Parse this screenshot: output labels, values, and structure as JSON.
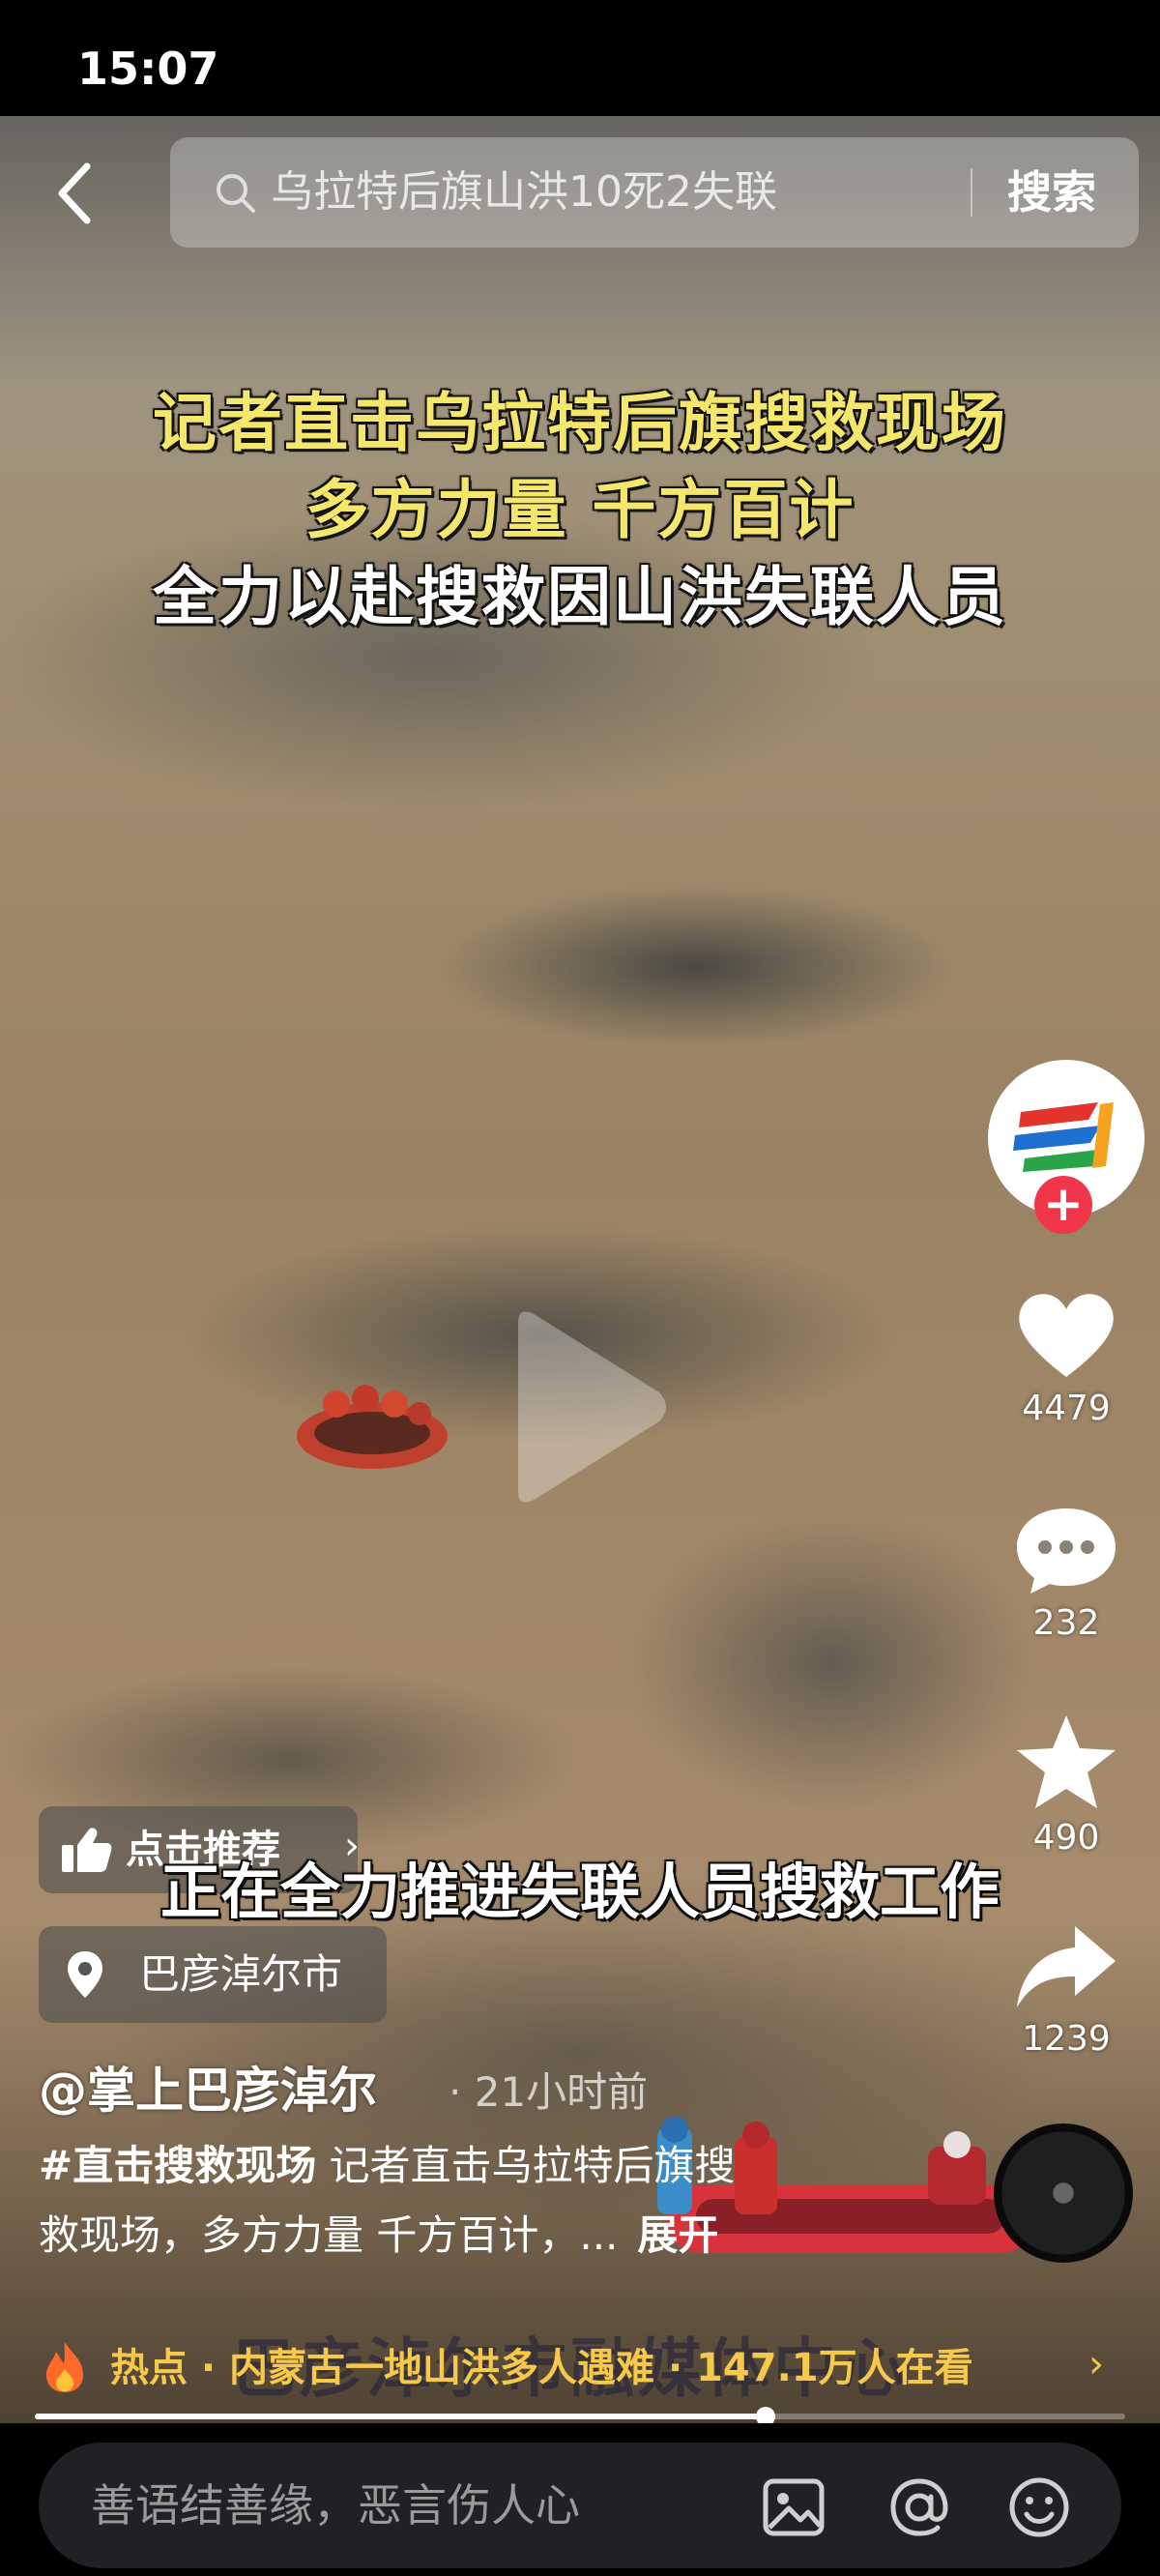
{
  "status_bar": {
    "time": "15:07"
  },
  "search": {
    "query": "乌拉特后旗山洪10死2失联",
    "button_label": "搜索"
  },
  "video": {
    "headline_lines": [
      "记者直击乌拉特后旗搜救现场",
      "多方力量 千方百计",
      "全力以赴搜救因山洪失联人员"
    ],
    "subtitle": "正在全力推进失联人员搜救工作",
    "watermark": "巴彦淖尔市融媒体中心"
  },
  "actions": {
    "like_count": "4479",
    "comment_count": "232",
    "favorite_count": "490",
    "share_count": "1239"
  },
  "recommend_chip": {
    "label": "点击推荐"
  },
  "location_chip": {
    "label": "巴彦淖尔市"
  },
  "post": {
    "author": "@掌上巴彦淖尔",
    "time": "· 21小时前",
    "hashtag": "#直击搜救现场",
    "desc_line1": " 记者直击乌拉特后旗搜",
    "desc_line2": "救现场，多方力量 千方百计，...",
    "expand_label": "展开"
  },
  "hot_bar": {
    "text": "热点 · 内蒙古一地山洪多人遇难 · 147.1万人在看"
  },
  "playback": {
    "progress_percent": 67
  },
  "comment_bar": {
    "placeholder": "善语结善缘，恶言伤人心"
  },
  "icons": {
    "back": "chevron-left-icon",
    "search": "search-icon",
    "like": "heart-icon",
    "comment": "comment-bubble-icon",
    "favorite": "star-icon",
    "share": "share-arrow-icon",
    "image": "image-icon",
    "mention": "at-sign-icon",
    "emoji": "emoji-icon",
    "hot": "flame-icon",
    "location": "location-pin-icon",
    "recommend": "thumbs-up-icon"
  },
  "colors": {
    "follow_badge": "#f2364a",
    "hot_text": "#f7c94b",
    "headline_yellow": "#f4e76b"
  }
}
